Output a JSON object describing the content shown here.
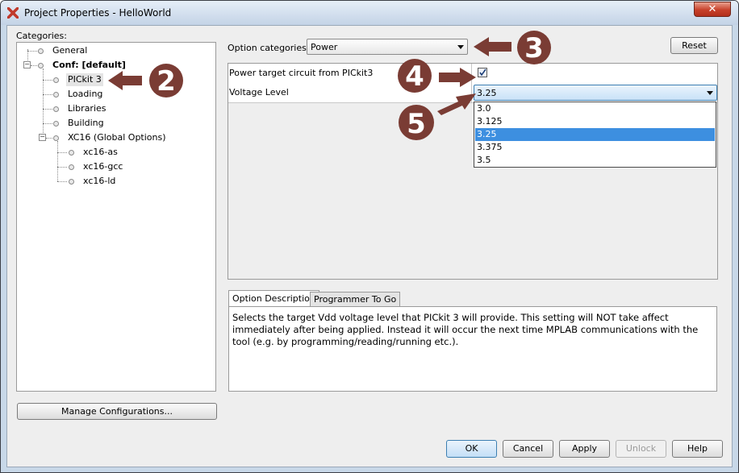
{
  "window": {
    "title": "Project Properties - HelloWorld",
    "close_label": "✕"
  },
  "categories": {
    "label": "Categories:",
    "items": [
      {
        "label": "General",
        "bold": false
      },
      {
        "label": "Conf: [default]",
        "bold": true
      },
      {
        "label": "PICkit 3",
        "bold": false
      },
      {
        "label": "Loading",
        "bold": false
      },
      {
        "label": "Libraries",
        "bold": false
      },
      {
        "label": "Building",
        "bold": false
      },
      {
        "label": "XC16 (Global Options)",
        "bold": false
      },
      {
        "label": "xc16-as",
        "bold": false
      },
      {
        "label": "xc16-gcc",
        "bold": false
      },
      {
        "label": "xc16-ld",
        "bold": false
      }
    ],
    "selected": "PICkit 3"
  },
  "manage_button": "Manage Configurations...",
  "option_categories": {
    "label": "Option categories:",
    "value": "Power"
  },
  "reset_button": "Reset",
  "properties": [
    {
      "label": "Power target circuit from PICkit3",
      "checked": true
    },
    {
      "label": "Voltage Level",
      "value": "3.25"
    }
  ],
  "voltage_options": [
    "3.0",
    "3.125",
    "3.25",
    "3.375",
    "3.5"
  ],
  "voltage_selected": "3.25",
  "tabs": [
    "Option Description",
    "Programmer To Go"
  ],
  "description": "Selects the target Vdd voltage level that PICkit 3 will provide. This setting will NOT take affect immediately after being applied. Instead it will occur the next time MPLAB communications with the tool (e.g. by programming/reading/running etc.).",
  "footer_buttons": {
    "ok": "OK",
    "cancel": "Cancel",
    "apply": "Apply",
    "unlock": "Unlock",
    "help": "Help"
  },
  "annotations": {
    "a2": "2",
    "a3": "3",
    "a4": "4",
    "a5": "5"
  },
  "colors": {
    "annotation": "#7a3c34",
    "selection": "#3d8fe0",
    "accent_border": "#3c7fb1"
  }
}
